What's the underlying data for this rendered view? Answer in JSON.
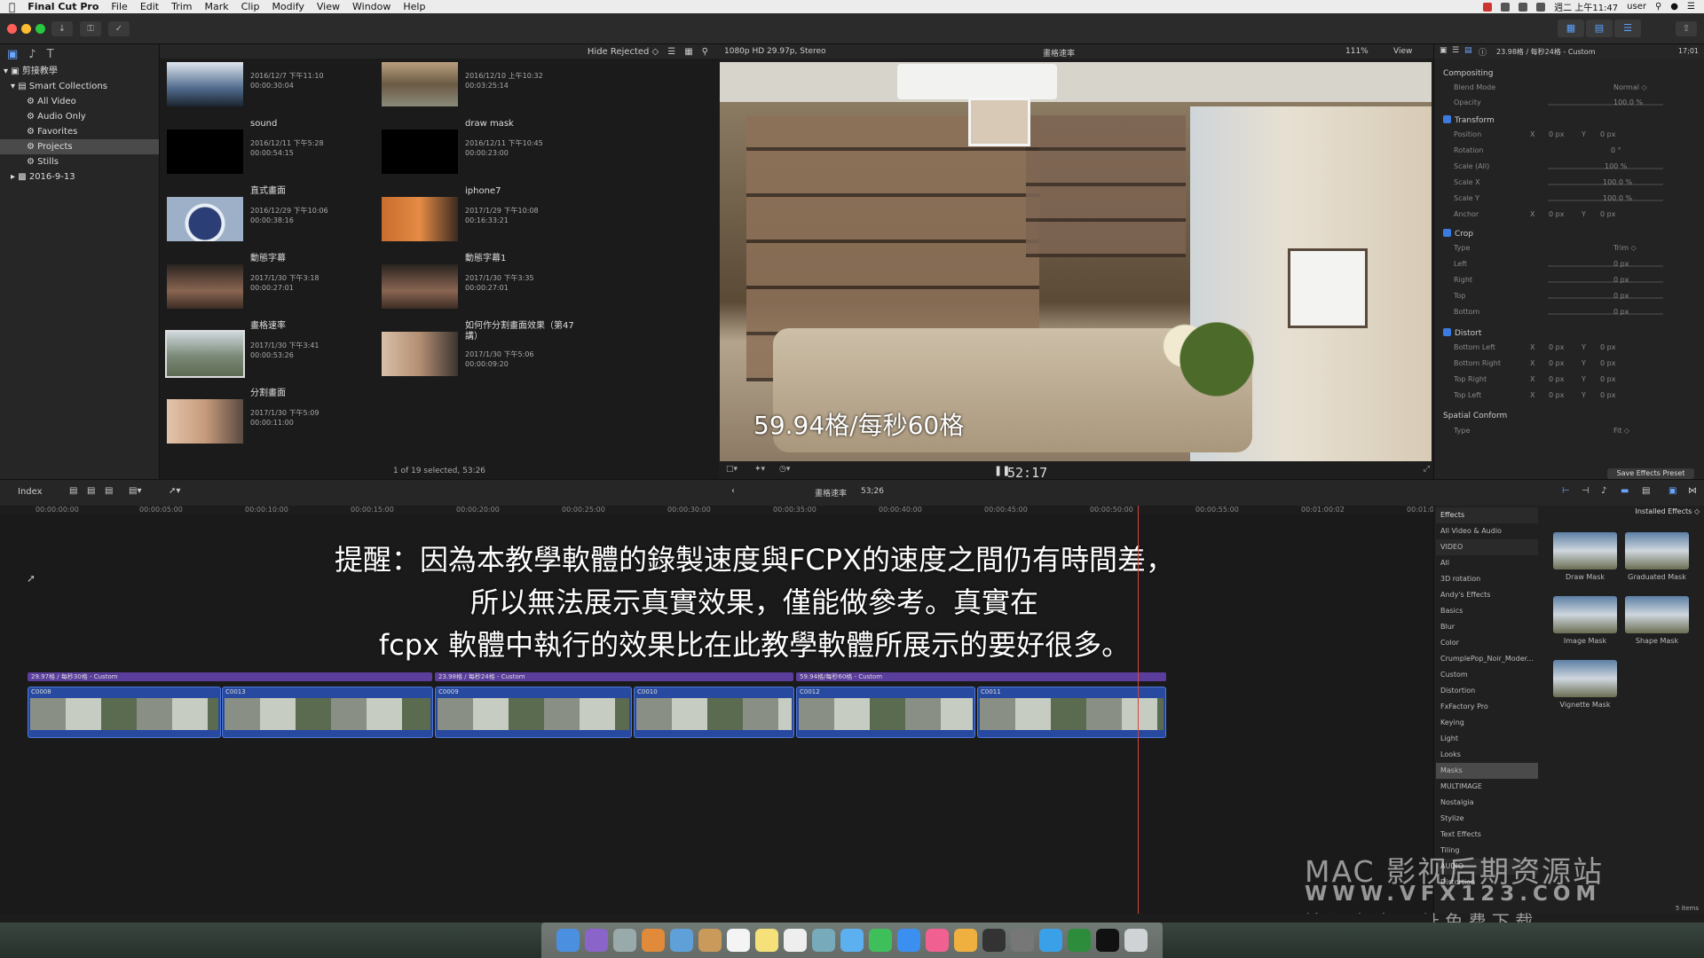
{
  "menubar": {
    "app_name": "Final Cut Pro",
    "menus": [
      "File",
      "Edit",
      "Trim",
      "Mark",
      "Clip",
      "Modify",
      "View",
      "Window",
      "Help"
    ],
    "clock": "週二 上午11:47",
    "user": "user"
  },
  "library": {
    "name": "剪接教學",
    "items": [
      "Smart Collections",
      "All Video",
      "Audio Only",
      "Favorites",
      "Projects",
      "Stills",
      "2016-9-13"
    ],
    "selected": "Projects"
  },
  "browser": {
    "filter": "Hide Rejected ◇",
    "clips": [
      {
        "name": "",
        "date": "2016/12/7 下午11:10",
        "duration": "00:00:30:04"
      },
      {
        "name": "",
        "date": "2016/12/10 上午10:32",
        "duration": "00:03:25:14"
      },
      {
        "name": "sound",
        "date": "2016/12/11 下午5:28",
        "duration": "00:00:54:15"
      },
      {
        "name": "draw mask",
        "date": "2016/12/11 下午10:45",
        "duration": "00:00:23:00"
      },
      {
        "name": "直式畫面",
        "date": "2016/12/29 下午10:06",
        "duration": "00:00:38:16"
      },
      {
        "name": "iphone7",
        "date": "2017/1/29 下午10:08",
        "duration": "00:16:33:21"
      },
      {
        "name": "動態字幕",
        "date": "2017/1/30 下午3:18",
        "duration": "00:00:27:01"
      },
      {
        "name": "動態字幕1",
        "date": "2017/1/30 下午3:35",
        "duration": "00:00:27:01"
      },
      {
        "name": "畫格速率",
        "date": "2017/1/30 下午3:41",
        "duration": "00:00:53:26"
      },
      {
        "name": "如何作分割畫面效果（第47講）",
        "date": "2017/1/30 下午5:06",
        "duration": "00:00:09:20"
      },
      {
        "name": "分割畫面",
        "date": "2017/1/30 下午5:09",
        "duration": "00:00:11:00"
      }
    ],
    "status": "1 of 19 selected, 53:26"
  },
  "viewer": {
    "format": "1080p HD 29.97p, Stereo",
    "project": "畫格速率",
    "zoom": "111%",
    "view": "View",
    "caption": "59.94格/每秒60格",
    "timecode": "52:17"
  },
  "inspector": {
    "header": "23.98格 / 每秒24格 - Custom",
    "duration": "17;01",
    "compositing": "Compositing",
    "blend_mode_label": "Blend Mode",
    "blend_mode": "Normal ◇",
    "opacity_label": "Opacity",
    "opacity": "100.0 %",
    "transform": "Transform",
    "position_label": "Position",
    "rotation_label": "Rotation",
    "rotation": "0 °",
    "scale_all_label": "Scale (All)",
    "scale_all": "100 %",
    "scale_x_label": "Scale X",
    "scale_y_label": "Scale Y",
    "scale_pct": "100.0 %",
    "anchor_label": "Anchor",
    "crop": "Crop",
    "type_label": "Type",
    "crop_type": "Trim ◇",
    "left_label": "Left",
    "right_label": "Right",
    "top_label": "Top",
    "bottom_label": "Bottom",
    "distort": "Distort",
    "bottom_left_label": "Bottom Left",
    "bottom_right_label": "Bottom Right",
    "top_right_label": "Top Right",
    "top_left_label": "Top Left",
    "spatial_conform": "Spatial Conform",
    "conform_type": "Fit ◇",
    "px_zero": "0 px",
    "x": "X",
    "y": "Y",
    "save_button": "Save Effects Preset"
  },
  "timeline": {
    "index": "Index",
    "project": "畫格速率",
    "duration": "53;26",
    "ruler": [
      "00:00:00:00",
      "00:00:05:00",
      "00:00:10:00",
      "00:00:15:00",
      "00:00:20:00",
      "00:00:25:00",
      "00:00:30:00",
      "00:00:35:00",
      "00:00:40:00",
      "00:00:45:00",
      "00:00:50:00",
      "00:00:55:00",
      "00:01:00:02",
      "00:01:0"
    ],
    "notice_lines": [
      "提醒：因為本教學軟體的錄製速度與FCPX的速度之間仍有時間差，",
      "所以無法展示真實效果，僅能做參考。真實在",
      "fcpx 軟體中執行的效果比在此教學軟體所展示的要好很多。"
    ],
    "compound_labels": [
      "29.97格 / 每秒30格 - Custom",
      "23.98格 / 每秒24格 - Custom",
      "59.94格/每秒60格 - Custom"
    ],
    "clips": [
      "C0008",
      "C0013",
      "C0009",
      "C0010",
      "C0012",
      "C0011"
    ]
  },
  "effects": {
    "title": "Effects",
    "installed": "Installed Effects ◇",
    "categories": [
      "All Video & Audio",
      "VIDEO",
      "All",
      "3D rotation",
      "Andy's Effects",
      "Basics",
      "Blur",
      "Color",
      "CrumplePop_Noir_Moder...",
      "Custom",
      "Distortion",
      "FxFactory Pro",
      "Keying",
      "Light",
      "Looks",
      "Masks",
      "MULTIMAGE",
      "Nostalgia",
      "Stylize",
      "Text Effects",
      "Tiling",
      "AUDIO",
      "Distortion"
    ],
    "selected": "Masks",
    "items": [
      "Draw Mask",
      "Graduated Mask",
      "Image Mask",
      "Shape Mask",
      "Vignette Mask"
    ],
    "count": "5 items"
  },
  "watermark": {
    "line1": "MAC 影视后期资源站",
    "line2": "WWW.VFX123.COM",
    "line3": "输 入 上 方 网 址   免 费 下 载"
  }
}
